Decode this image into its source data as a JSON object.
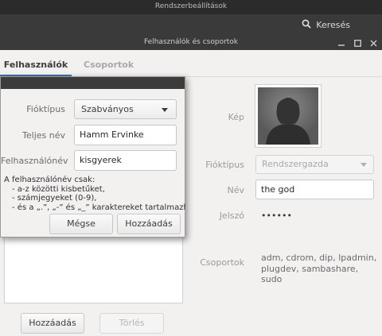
{
  "app": {
    "title": "Rendszerbeállítások",
    "search_label": "Keresés",
    "window_title": "Felhasználók és csoportok"
  },
  "tabs": [
    {
      "label": "Felhasználók",
      "active": true
    },
    {
      "label": "Csoportok",
      "active": false
    }
  ],
  "left_panel": {
    "add_button": "Hozzáadás",
    "delete_button": "Törlés"
  },
  "details": {
    "picture_label": "Kép",
    "account_type_label": "Fióktípus",
    "account_type_value": "Rendszergazda",
    "name_label": "Név",
    "name_value": "the god",
    "password_label": "Jelszó",
    "password_value": "••••••",
    "groups_label": "Csoportok",
    "groups_line1": "adm, cdrom, dip, lpadmin,",
    "groups_line2": "plugdev, sambashare, sudo"
  },
  "dialog": {
    "account_type_label": "Fióktípus",
    "account_type_value": "Szabványos",
    "full_name_label": "Teljes név",
    "full_name_value": "Hamm Ervinke",
    "username_label": "Felhasználónév",
    "username_value": "kisgyerek",
    "hint_title": "A felhasználónév csak:",
    "hint_line1": "- a-z közötti kisbetűket,",
    "hint_line2": "- számjegyeket (0-9),",
    "hint_line3": "- és a „.”, „-” és „_” karaktereket tartalmazhatja",
    "cancel_button": "Mégse",
    "add_button": "Hozzáadás"
  },
  "colors": {
    "accent": "#3b6fa5",
    "titlebar": "#2b2b2b",
    "toolbar": "#3a3a3a"
  }
}
